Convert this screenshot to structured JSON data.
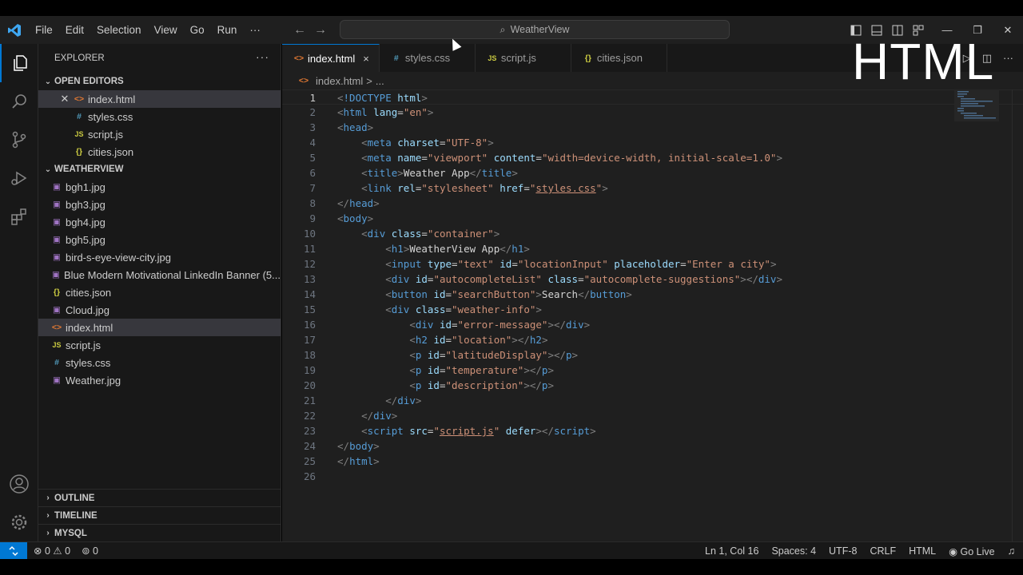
{
  "titlebar": {
    "menu": [
      "File",
      "Edit",
      "Selection",
      "View",
      "Go",
      "Run",
      "···"
    ],
    "search_text": "WeatherView"
  },
  "overlay_text": "HTML",
  "explorer": {
    "title": "EXPLORER",
    "more": "···",
    "open_editors_label": "OPEN EDITORS",
    "open_editors": [
      {
        "name": "index.html",
        "icon": "<>"
      },
      {
        "name": "styles.css",
        "icon": "#"
      },
      {
        "name": "script.js",
        "icon": "JS"
      },
      {
        "name": "cities.json",
        "icon": "{}"
      }
    ],
    "project_label": "WEATHERVIEW",
    "files": [
      {
        "name": "bgh1.jpg",
        "icon": "▣"
      },
      {
        "name": "bgh3.jpg",
        "icon": "▣"
      },
      {
        "name": "bgh4.jpg",
        "icon": "▣"
      },
      {
        "name": "bgh5.jpg",
        "icon": "▣"
      },
      {
        "name": "bird-s-eye-view-city.jpg",
        "icon": "▣"
      },
      {
        "name": "Blue Modern Motivational LinkedIn Banner (5...",
        "icon": "▣"
      },
      {
        "name": "cities.json",
        "icon": "{}"
      },
      {
        "name": "Cloud.jpg",
        "icon": "▣"
      },
      {
        "name": "index.html",
        "icon": "<>"
      },
      {
        "name": "script.js",
        "icon": "JS"
      },
      {
        "name": "styles.css",
        "icon": "#"
      },
      {
        "name": "Weather.jpg",
        "icon": "▣"
      }
    ],
    "bottom_sections": [
      "OUTLINE",
      "TIMELINE",
      "MYSQL"
    ]
  },
  "tabs": [
    {
      "label": "index.html",
      "icon": "<>",
      "close": "×"
    },
    {
      "label": "styles.css",
      "icon": "#"
    },
    {
      "label": "script.js",
      "icon": "JS"
    },
    {
      "label": "cities.json",
      "icon": "{}"
    }
  ],
  "breadcrumb": {
    "file": "index.html",
    "sep": ">",
    "rest": "..."
  },
  "code_lines": [
    "1",
    "2",
    "3",
    "4",
    "5",
    "6",
    "7",
    "8",
    "9",
    "10",
    "11",
    "12",
    "13",
    "14",
    "15",
    "16",
    "17",
    "18",
    "19",
    "20",
    "21",
    "22",
    "23",
    "24",
    "25",
    "26"
  ],
  "statusbar": {
    "errors": "0",
    "warnings": "0",
    "ports": "0",
    "position": "Ln 1, Col 16",
    "spaces": "Spaces: 4",
    "encoding": "UTF-8",
    "eol": "CRLF",
    "language": "HTML",
    "golive": "Go Live"
  },
  "colors": {
    "accent": "#0078d4",
    "editor_bg": "#1f1f1f",
    "sidebar_bg": "#181818"
  },
  "icons": [
    "vscode-logo-icon",
    "explorer-icon",
    "search-icon",
    "source-control-icon",
    "run-debug-icon",
    "extensions-icon",
    "account-icon",
    "gear-icon"
  ]
}
